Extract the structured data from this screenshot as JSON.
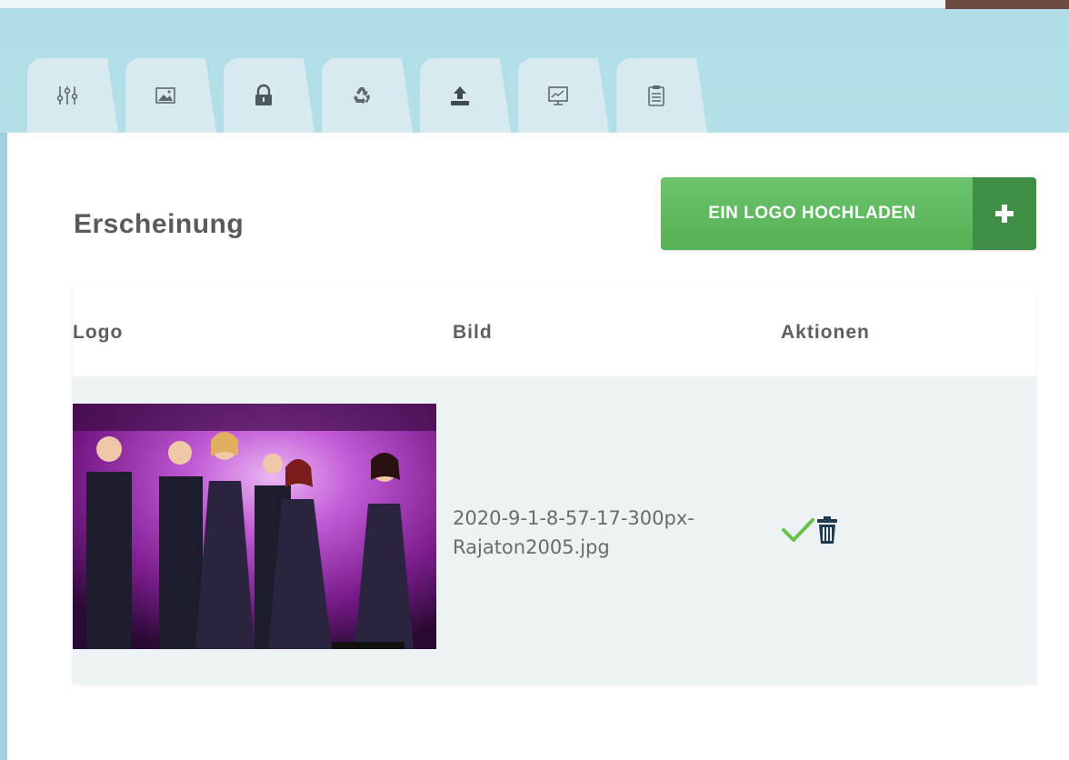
{
  "tabs": [
    {
      "icon": "sliders-icon",
      "active": false
    },
    {
      "icon": "image-icon",
      "active": true
    },
    {
      "icon": "lock-icon",
      "active": false
    },
    {
      "icon": "recycle-icon",
      "active": false
    },
    {
      "icon": "upload-icon",
      "active": false
    },
    {
      "icon": "monitor-chart-icon",
      "active": false
    },
    {
      "icon": "clipboard-icon",
      "active": false
    }
  ],
  "section": {
    "title": "Erscheinung"
  },
  "toolbar": {
    "upload_label": "EIN LOGO HOCHLADEN",
    "upload_icon": "plus-icon"
  },
  "table": {
    "columns": [
      "Logo",
      "Bild",
      "Aktionen"
    ],
    "rows": [
      {
        "filename": "2020-9-1-8-57-17-300px-Rajaton2005.jpg",
        "filename_line1": "2020-9-1-8-57-17-300px-",
        "filename_line2": "Rajaton2005.jpg",
        "actions": [
          "check-icon",
          "trash-icon"
        ]
      }
    ]
  },
  "colors": {
    "accent_green": "#5cb85c",
    "accent_green_dark": "#3e8e45",
    "check_green": "#6cc04a",
    "trash_navy": "#1f3a4d",
    "tab_bg": "#d8e9ef",
    "row_bg": "#edf3f5"
  }
}
